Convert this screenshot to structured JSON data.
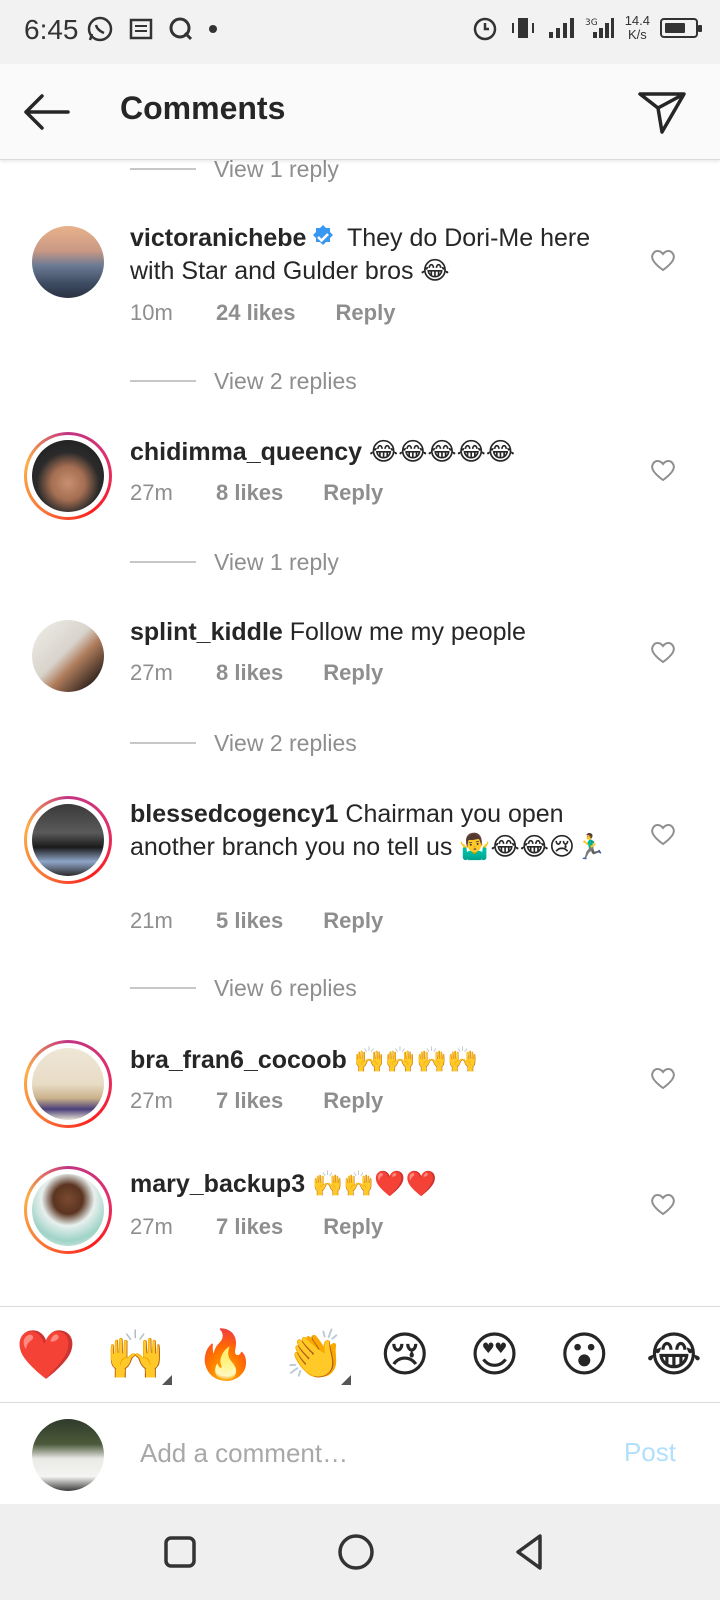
{
  "status_bar": {
    "time": "6:45",
    "network_speed": "14.4",
    "network_speed_unit": "K/s",
    "battery_level": 0.7
  },
  "header": {
    "title": "Comments"
  },
  "comments": [
    {
      "view_replies_before": "View 1 reply"
    },
    {
      "username": "victoranichebe",
      "verified": true,
      "text": " They do Dori-Me here with Star and Gulder bros 😂",
      "time": "10m",
      "likes": "24 likes",
      "reply": "Reply",
      "view_replies": "View 2 replies"
    },
    {
      "username": "chidimma_queency",
      "text": " 😂😂😂😂😂",
      "time": "27m",
      "likes": "8 likes",
      "reply": "Reply",
      "view_replies": "View 1 reply"
    },
    {
      "username": "splint_kiddle",
      "text": " Follow me my people",
      "time": "27m",
      "likes": "8 likes",
      "reply": "Reply",
      "view_replies": "View 2 replies"
    },
    {
      "username": "blessedcogency1",
      "text": " Chairman you open another branch you no tell us 🤷‍♂️😂😂😢🏃‍♂️",
      "time": "21m",
      "likes": "5 likes",
      "reply": "Reply",
      "view_replies": "View 6 replies"
    },
    {
      "username": "bra_fran6_cocoob",
      "text": " 🙌🙌🙌🙌",
      "time": "27m",
      "likes": "7 likes",
      "reply": "Reply"
    },
    {
      "username": "mary_backup3",
      "text": " 🙌🙌❤️❤️",
      "time": "27m",
      "likes": "7 likes",
      "reply": "Reply"
    }
  ],
  "emoji_bar": [
    "❤️",
    "🙌",
    "🔥",
    "👏",
    "😢",
    "😍",
    "😮",
    "😂"
  ],
  "input": {
    "placeholder": "Add a comment…",
    "post_label": "Post"
  },
  "colors": {
    "verified_blue": "#3897f0",
    "post_disabled": "#b2dffc",
    "secondary_text": "#8e8e8e"
  }
}
